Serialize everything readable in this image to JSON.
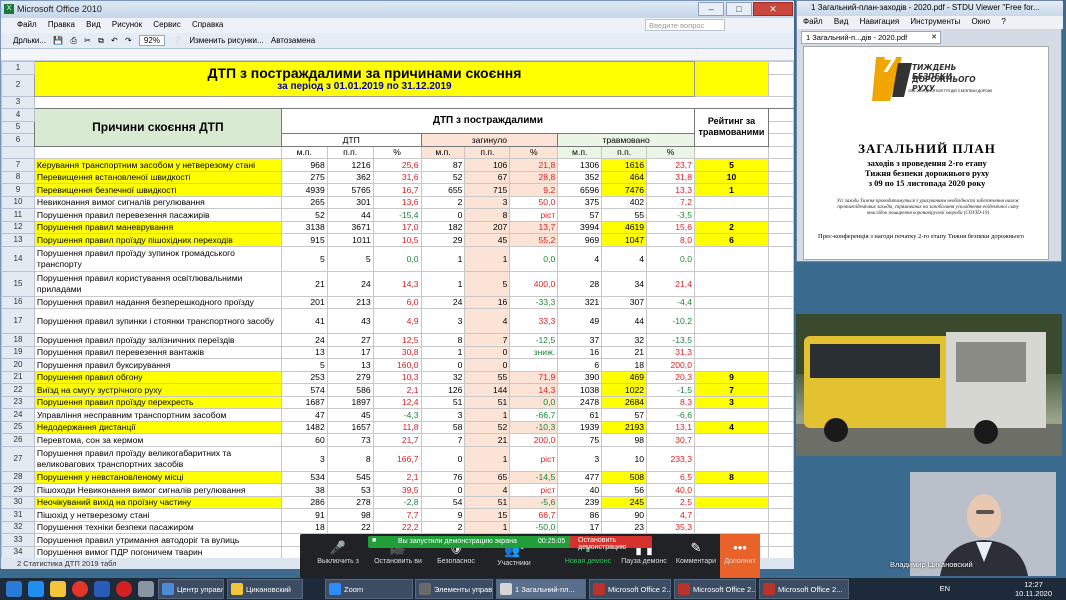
{
  "excel": {
    "title": "Microsoft Office 2010",
    "menu": [
      "Файл",
      "Правка",
      "Вид",
      "Рисунок",
      "Сервис",
      "Справка"
    ],
    "help_placeholder": "Введите вопрос",
    "toolbar": {
      "drawing": "Дрльки...",
      "zoom": "92%",
      "change_pictures": "Изменить рисунки...",
      "autoreplace": "Автозамена"
    },
    "sheet_tab": "2 Статистика ДТП 2019 табл",
    "header": {
      "title": "ДТП з постраждалими за причинами скоєння",
      "period": "за період з 01.01.2019 по 31.12.2019",
      "causes": "Причини скоєння ДТП",
      "group": "ДТП з постраждалими",
      "rating": "Рейтинг за травмованими",
      "dtp": "ДТП",
      "killed": "загинуло",
      "injured": "травмовано",
      "mp": "м.п.",
      "pp": "п.п.",
      "pct": "%"
    },
    "rows": [
      {
        "n": "7",
        "cause": "Керування транспортним засобом у нетверезому стані",
        "v": [
          "968",
          "1216",
          "25,6",
          "87",
          "106",
          "21,8",
          "1306",
          "1616",
          "23,7"
        ],
        "rating": "5",
        "hl": true
      },
      {
        "n": "8",
        "cause": "Перевищення встановленої швидкості",
        "v": [
          "275",
          "362",
          "31,6",
          "52",
          "67",
          "28,8",
          "352",
          "464",
          "31,8"
        ],
        "rating": "10",
        "hl": true
      },
      {
        "n": "9",
        "cause": "Перевищення безпечної швидкості",
        "v": [
          "4939",
          "5765",
          "16,7",
          "655",
          "715",
          "9,2",
          "6596",
          "7476",
          "13,3"
        ],
        "rating": "1",
        "hl": true
      },
      {
        "n": "10",
        "cause": "Невиконання вимог сигналів регулювання",
        "v": [
          "265",
          "301",
          "13,6",
          "2",
          "3",
          "50,0",
          "375",
          "402",
          "7,2"
        ],
        "rating": "",
        "hl": false
      },
      {
        "n": "11",
        "cause": "Порушення правил перевезення пасажирів",
        "v": [
          "52",
          "44",
          "-15,4",
          "0",
          "8",
          "ріст",
          "57",
          "55",
          "-3,5"
        ],
        "rating": "",
        "hl": false
      },
      {
        "n": "12",
        "cause": "Порушення правил маневрування",
        "v": [
          "3138",
          "3671",
          "17,0",
          "182",
          "207",
          "13,7",
          "3994",
          "4619",
          "15,6"
        ],
        "rating": "2",
        "hl": true
      },
      {
        "n": "13",
        "cause": "Порушення правил проїзду пішохідних переходів",
        "v": [
          "915",
          "1011",
          "10,5",
          "29",
          "45",
          "55,2",
          "969",
          "1047",
          "8,0"
        ],
        "rating": "6",
        "hl": true
      },
      {
        "n": "14",
        "cause": "Порушення правил проїзду зупинок громадського транспорту",
        "v": [
          "5",
          "5",
          "0,0",
          "1",
          "1",
          "0,0",
          "4",
          "4",
          "0,0"
        ],
        "rating": "",
        "hl": false,
        "tall": true
      },
      {
        "n": "15",
        "cause": "Порушення правил користування освітлювальними приладами",
        "v": [
          "21",
          "24",
          "14,3",
          "1",
          "5",
          "400,0",
          "28",
          "34",
          "21,4"
        ],
        "rating": "",
        "hl": false,
        "tall": true
      },
      {
        "n": "16",
        "cause": "Порушення правил надання безперешкодного проїзду",
        "v": [
          "201",
          "213",
          "6,0",
          "24",
          "16",
          "-33,3",
          "321",
          "307",
          "-4,4"
        ],
        "rating": "",
        "hl": false
      },
      {
        "n": "17",
        "cause": "Порушення правил зупинки і стоянки транспортного засобу",
        "v": [
          "41",
          "43",
          "4,9",
          "3",
          "4",
          "33,3",
          "49",
          "44",
          "-10,2"
        ],
        "rating": "",
        "hl": false,
        "tall": true
      },
      {
        "n": "18",
        "cause": "Порушення правил проїзду залізничних переїздів",
        "v": [
          "24",
          "27",
          "12,5",
          "8",
          "7",
          "-12,5",
          "37",
          "32",
          "-13,5"
        ],
        "rating": "",
        "hl": false
      },
      {
        "n": "19",
        "cause": "Порушення правил перевезення вантажів",
        "v": [
          "13",
          "17",
          "30,8",
          "1",
          "0",
          "зниж.",
          "16",
          "21",
          "31,3"
        ],
        "rating": "",
        "hl": false
      },
      {
        "n": "20",
        "cause": "Порушення правил буксирування",
        "v": [
          "5",
          "13",
          "160,0",
          "0",
          "0",
          "",
          "6",
          "18",
          "200,0"
        ],
        "rating": "",
        "hl": false
      },
      {
        "n": "21",
        "cause": "Порушення правил обгону",
        "v": [
          "253",
          "279",
          "10,3",
          "32",
          "55",
          "71,9",
          "390",
          "469",
          "20,3"
        ],
        "rating": "9",
        "hl": true
      },
      {
        "n": "22",
        "cause": "Виїзд на смугу зустрічного руху",
        "v": [
          "574",
          "586",
          "2,1",
          "126",
          "144",
          "14,3",
          "1038",
          "1022",
          "-1,5"
        ],
        "rating": "7",
        "hl": true
      },
      {
        "n": "23",
        "cause": "Порушення правил проїзду перехресть",
        "v": [
          "1687",
          "1897",
          "12,4",
          "51",
          "51",
          "0,0",
          "2478",
          "2684",
          "8,3"
        ],
        "rating": "3",
        "hl": true
      },
      {
        "n": "24",
        "cause": "Управління несправним транспортним засобом",
        "v": [
          "47",
          "45",
          "-4,3",
          "3",
          "1",
          "-66,7",
          "61",
          "57",
          "-6,6"
        ],
        "rating": "",
        "hl": false
      },
      {
        "n": "25",
        "cause": "Недодержання дистанції",
        "v": [
          "1482",
          "1657",
          "11,8",
          "58",
          "52",
          "-10,3",
          "1939",
          "2193",
          "13,1"
        ],
        "rating": "4",
        "hl": true
      },
      {
        "n": "26",
        "cause": "Перевтома, сон за кермом",
        "v": [
          "60",
          "73",
          "21,7",
          "7",
          "21",
          "200,0",
          "75",
          "98",
          "30,7"
        ],
        "rating": "",
        "hl": false
      },
      {
        "n": "27",
        "cause": "Порушення правил проїзду великогабаритних та великовагових транспортних засобів",
        "v": [
          "3",
          "8",
          "166,7",
          "0",
          "1",
          "ріст",
          "3",
          "10",
          "233,3"
        ],
        "rating": "",
        "hl": false,
        "tall": true
      },
      {
        "n": "28",
        "cause": "Порушення у невстановленому місці",
        "v": [
          "534",
          "545",
          "2,1",
          "76",
          "65",
          "-14,5",
          "477",
          "508",
          "6,5"
        ],
        "rating": "8",
        "hl": true
      },
      {
        "n": "29",
        "cause": "Пішоходи Невиконання вимог сигналів регулювання",
        "v": [
          "38",
          "53",
          "39,5",
          "0",
          "4",
          "ріст",
          "40",
          "56",
          "40,0"
        ],
        "rating": "",
        "hl": false
      },
      {
        "n": "30",
        "cause": "Неочікуваний вихід на проїзну частину",
        "v": [
          "286",
          "278",
          "-2,8",
          "54",
          "51",
          "-5,6",
          "239",
          "245",
          "2,5"
        ],
        "rating": "",
        "hl": true
      },
      {
        "n": "31",
        "cause": "Пішохід у нетверезому стані",
        "v": [
          "91",
          "98",
          "7,7",
          "9",
          "15",
          "66,7",
          "86",
          "90",
          "4,7"
        ],
        "rating": "",
        "hl": false
      },
      {
        "n": "32",
        "cause": "Порушення техніки безпеки пасажиром",
        "v": [
          "18",
          "22",
          "22,2",
          "2",
          "1",
          "-50,0",
          "17",
          "23",
          "35,3"
        ],
        "rating": "",
        "hl": false
      },
      {
        "n": "33",
        "cause": "Порушення правил утримання автодоріг та вулиць",
        "v": [
          "7",
          "",
          "",
          "",
          "",
          "",
          "",
          "",
          "-8,3"
        ],
        "rating": "",
        "hl": false
      },
      {
        "n": "34",
        "cause": "Порушення вимог ПДР погоничем тварин",
        "v": [
          "",
          "",
          "",
          "",
          "",
          "",
          "",
          "",
          ""
        ],
        "rating": "",
        "hl": false
      }
    ]
  },
  "pdf": {
    "title": "1 Загальний-план-заходів - 2020.pdf - STDU Viewer \"Free for...",
    "menu": [
      "Файл",
      "Вид",
      "Навигация",
      "Инструменты",
      "Окно",
      "?"
    ],
    "tab": "1 Загальний-п...дів - 2020.pdf",
    "logo_line1": "ТИЖДЕНЬ БЕЗПЕКИ",
    "logo_line2": "ДОРОЖНЬОГО РУХУ",
    "logo_num": "7",
    "logo_sub": "2011-2020 ДЕСЯТИЛІТТЯ ДІЙ З БЕЗПЕКИ ДОРОЖНЬОГО РУХУ",
    "heading": "ЗАГАЛЬНИЙ ПЛАН",
    "sub1": "заходів з проведення 2-го етапу",
    "sub2": "Тижня безпеки дорожнього руху",
    "sub3": "з 09 по 15 листопада 2020 року",
    "small1": "Усі заходи Тижня проводитимуться з урахуванням необхідності забезпечення належ",
    "small2": "протиепідемічних заходів, спрямованих на запобігання ускладнення епідемічної ситу",
    "small3": "внаслідок поширення коронавірусної хвороби (COVID-19)",
    "press": "Прес-конференція з нагоди початку 2-го етапу Тижня безпеки дорожнього"
  },
  "zoom": {
    "share_banner": "Вы запустили демонстрацию экрана",
    "timer": "00:25:05",
    "stop": "Остановить демонстрацию",
    "buttons": [
      "Выключить з",
      "Остановить ви",
      "Безопаснос",
      "Участники",
      "Новая демонс",
      "Пауза демонс",
      "Комментари",
      "Дополнит"
    ],
    "participants_count": "1",
    "speaker": "Владимир Цикановский"
  },
  "taskbar": {
    "apps": [
      "Центр управлен...",
      "Цикановский",
      "Zoom",
      "Элементы управ...",
      "1 Загальний-пл...",
      "Microsoft Office 2...",
      "Microsoft Office 2...",
      "Microsoft Office 2..."
    ],
    "lang": "EN",
    "time": "12:27",
    "date": "10.11.2020"
  }
}
